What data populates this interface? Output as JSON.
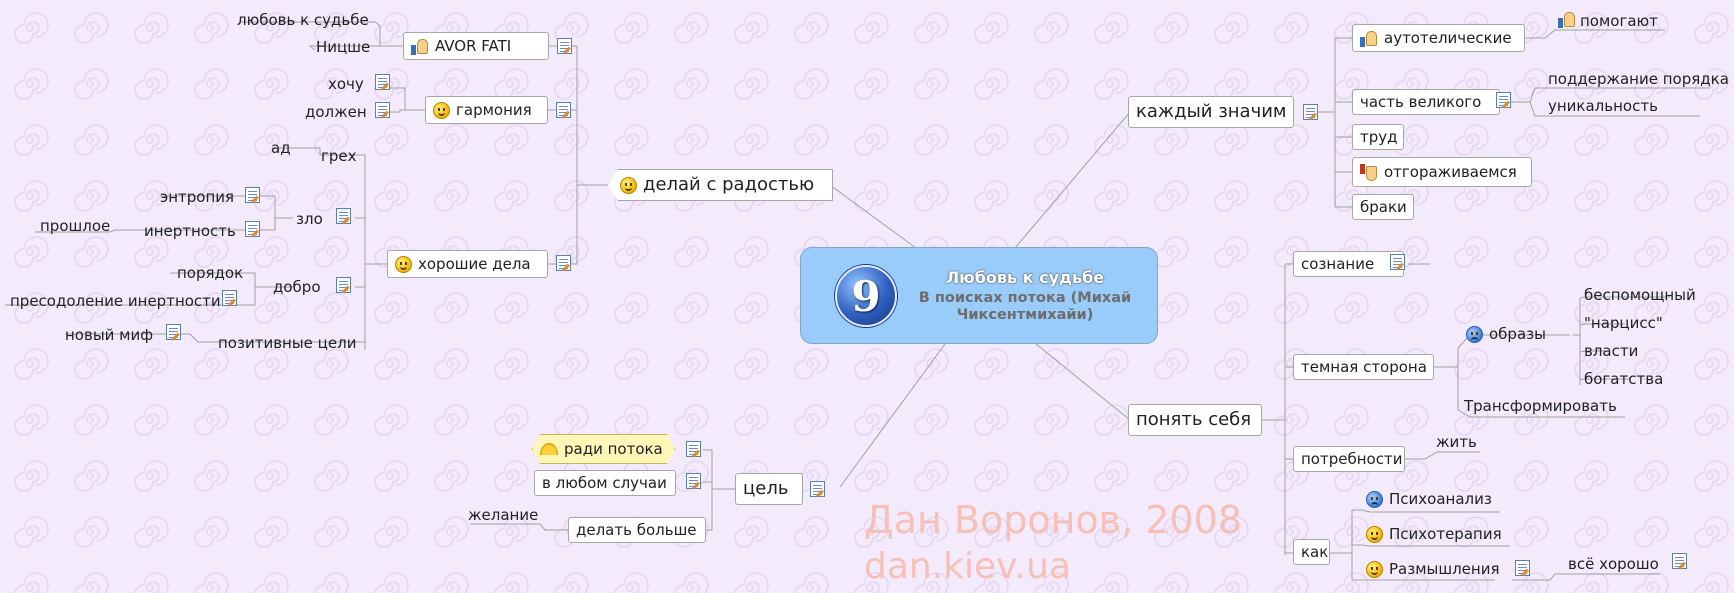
{
  "central": {
    "number": "9",
    "title": "Любовь к судьбе",
    "subtitle": "В поисках потока (Михай Чиксентмихайи)"
  },
  "left": {
    "delay": "делай с радостью",
    "amor": "AVOR FATI",
    "lyubov": "любовь к судьбе",
    "nitsshe": "Ницше",
    "garmoniya": "гармония",
    "hochu": "хочу",
    "dolzhen": "должен",
    "horoshie": "хорошие дела",
    "greh": "грех",
    "ad": "ад",
    "zlo": "зло",
    "entropiya": "энтропия",
    "inertnost": "инертность",
    "proshloe": "прошлое",
    "dobro": "добро",
    "poryadok": "порядок",
    "preodolenie": "пресодоление инертности",
    "pozitivnye": "позитивные цели",
    "novyi_mif": "новый миф",
    "tsel": "цель",
    "radi": "ради потока",
    "v_lyubom": "в любом случаи",
    "delat": "делать больше",
    "zhelanie": "желание"
  },
  "right": {
    "kazhdyi": "каждый значим",
    "autotel": "аутотелические",
    "pomogayut": "помогают",
    "chast": "часть великого",
    "podderzhanie": "поддержание порядка",
    "unikalnost": "уникальность",
    "trud": "труд",
    "otgrazh": "отгораживаемся",
    "braki": "браки",
    "ponyat": "понять себя",
    "soznanie": "сознание",
    "temnaya": "темная сторона",
    "obrazy": "образы",
    "bespomosh": "беспомощный",
    "narciss": "\"нарцисс\"",
    "vlasti": "власти",
    "bogatstva": "богатства",
    "transform": "Трансформировать",
    "potrebnosti": "потребности",
    "zhit": "жить",
    "kak": "как",
    "psihoanaliz": "Психоанализ",
    "psihoterapiya": "Психотерапия",
    "razmyshleniya": "Размышления",
    "vse_horosho": "всё хорошо"
  },
  "watermark": {
    "line1": "Дан Воронов, 2008",
    "line2": "dan.kiev.ua"
  },
  "colors": {
    "background": "#f3ebfb",
    "central_fill": "#99ccfb",
    "connector": "#a0a0a0",
    "watermark": "#f7bfb6"
  }
}
